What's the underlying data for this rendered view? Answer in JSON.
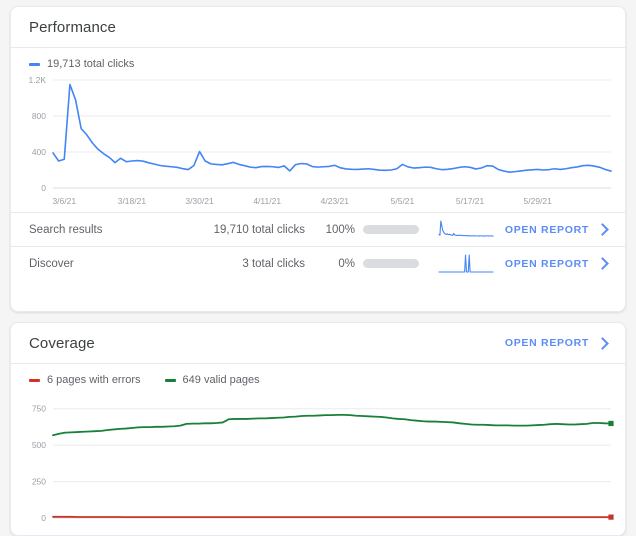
{
  "performance": {
    "title": "Performance",
    "legend": [
      {
        "label": "19,713 total clicks",
        "color": "#4285f4"
      }
    ],
    "rows": [
      {
        "label": "Search results",
        "clicks": "19,710 total clicks",
        "percent_label": "100%",
        "percent_value": 100,
        "link_label": "OPEN REPORT"
      },
      {
        "label": "Discover",
        "clicks": "3 total clicks",
        "percent_label": "0%",
        "percent_value": 0,
        "link_label": "OPEN REPORT"
      }
    ]
  },
  "coverage": {
    "title": "Coverage",
    "link_label": "OPEN REPORT",
    "legend": [
      {
        "label": "6 pages with errors",
        "color": "#d93025"
      },
      {
        "label": "649 valid pages",
        "color": "#188038"
      }
    ]
  },
  "chart_data": [
    {
      "id": "performance-chart",
      "type": "line",
      "title": "Performance",
      "xlabel": "",
      "ylabel": "",
      "ylim": [
        0,
        1200
      ],
      "yticks": [
        0,
        400,
        800,
        1200
      ],
      "ytick_labels": [
        "0",
        "400",
        "800",
        "1.2K"
      ],
      "xtick_labels": [
        "3/6/21",
        "3/18/21",
        "3/30/21",
        "4/11/21",
        "4/23/21",
        "5/5/21",
        "5/17/21",
        "5/29/21"
      ],
      "xtick_indices": [
        2,
        14,
        26,
        38,
        50,
        62,
        74,
        86
      ],
      "grid": true,
      "legend_position": "top-left",
      "series": [
        {
          "name": "19,713 total clicks",
          "color": "#4285f4",
          "values": [
            390,
            300,
            320,
            1150,
            980,
            660,
            590,
            500,
            430,
            380,
            340,
            282,
            330,
            292,
            300,
            305,
            298,
            280,
            265,
            250,
            242,
            236,
            230,
            215,
            205,
            250,
            405,
            300,
            268,
            262,
            258,
            270,
            285,
            262,
            248,
            232,
            226,
            238,
            240,
            236,
            228,
            246,
            190,
            258,
            272,
            268,
            238,
            232,
            236,
            240,
            252,
            224,
            212,
            208,
            206,
            210,
            214,
            206,
            198,
            196,
            200,
            214,
            262,
            234,
            222,
            226,
            232,
            230,
            214,
            204,
            208,
            216,
            228,
            236,
            230,
            212,
            222,
            248,
            244,
            206,
            188,
            176,
            182,
            190,
            198,
            202,
            206,
            200,
            204,
            214,
            206,
            214,
            226,
            234,
            248,
            252,
            244,
            230,
            206,
            188
          ]
        }
      ]
    },
    {
      "id": "coverage-chart",
      "type": "line",
      "title": "Coverage",
      "xlabel": "",
      "ylabel": "",
      "ylim": [
        0,
        810
      ],
      "yticks": [
        0,
        250,
        500,
        750
      ],
      "ytick_labels": [
        "0",
        "250",
        "500",
        "750"
      ],
      "grid": true,
      "legend_position": "top-left",
      "series": [
        {
          "name": "649 valid pages",
          "color": "#188038",
          "end_marker": true,
          "values": [
            568,
            578,
            586,
            588,
            590,
            592,
            594,
            596,
            598,
            604,
            608,
            612,
            614,
            618,
            622,
            624,
            624,
            626,
            626,
            628,
            630,
            634,
            646,
            648,
            648,
            650,
            650,
            652,
            656,
            678,
            680,
            680,
            680,
            682,
            684,
            684,
            686,
            688,
            690,
            694,
            696,
            700,
            702,
            702,
            704,
            706,
            706,
            708,
            708,
            706,
            702,
            700,
            698,
            696,
            694,
            690,
            684,
            680,
            678,
            672,
            668,
            664,
            662,
            662,
            660,
            658,
            656,
            650,
            646,
            642,
            640,
            640,
            638,
            636,
            636,
            636,
            634,
            634,
            634,
            636,
            638,
            640,
            644,
            646,
            644,
            642,
            642,
            644,
            646,
            652,
            652,
            650,
            649
          ]
        },
        {
          "name": "6 pages with errors",
          "color": "#c5372c",
          "end_marker": true,
          "values": [
            8,
            8,
            8,
            8,
            7,
            7,
            7,
            7,
            7,
            7,
            7,
            7,
            6,
            6,
            6,
            6,
            6,
            6,
            6,
            6,
            6,
            6,
            6,
            6,
            6,
            6,
            6,
            6,
            6,
            6,
            6,
            6,
            6,
            6,
            6,
            6,
            6,
            6,
            6,
            6,
            6,
            6,
            6,
            6,
            6,
            6,
            6,
            6,
            6,
            6,
            6,
            6,
            6,
            6,
            6,
            6,
            6,
            6,
            6,
            6,
            6,
            6,
            6,
            6,
            6,
            6,
            6,
            6,
            6,
            6,
            6,
            6,
            6,
            6,
            6,
            6,
            6,
            6,
            6,
            6,
            6,
            6,
            6,
            6,
            6,
            6,
            6,
            6,
            6,
            6,
            6,
            6,
            6
          ]
        }
      ]
    },
    {
      "id": "search-results-sparkline",
      "type": "line",
      "title": "Search results clicks sparkline",
      "series": [
        {
          "name": "Search results",
          "color": "#4285f4",
          "values": [
            20,
            16,
            96,
            70,
            44,
            34,
            26,
            22,
            20,
            24,
            19,
            21,
            20,
            18,
            16,
            15,
            26,
            18,
            16,
            15,
            14,
            15,
            14,
            16,
            15,
            14,
            13,
            14,
            13,
            14,
            13,
            12,
            13,
            12,
            13,
            12,
            12,
            12,
            13,
            12,
            12,
            12,
            12,
            12,
            11,
            12,
            12,
            12,
            12,
            11,
            11,
            12,
            12,
            12,
            11,
            12,
            12,
            12,
            11,
            11
          ]
        }
      ]
    },
    {
      "id": "discover-sparkline",
      "type": "line",
      "title": "Discover clicks sparkline",
      "series": [
        {
          "name": "Discover",
          "color": "#4285f4",
          "values": [
            0,
            0,
            0,
            0,
            0,
            0,
            0,
            0,
            0,
            0,
            0,
            0,
            0,
            0,
            0,
            0,
            0,
            0,
            0,
            0,
            0,
            0,
            0,
            0,
            0,
            0,
            0,
            0,
            0,
            100,
            0,
            0,
            0,
            100,
            0,
            0,
            0,
            0,
            0,
            0,
            0,
            0,
            0,
            0,
            0,
            0,
            0,
            0,
            0,
            0,
            0,
            0,
            0,
            0,
            0,
            0,
            0,
            0,
            0,
            0
          ]
        }
      ]
    }
  ]
}
